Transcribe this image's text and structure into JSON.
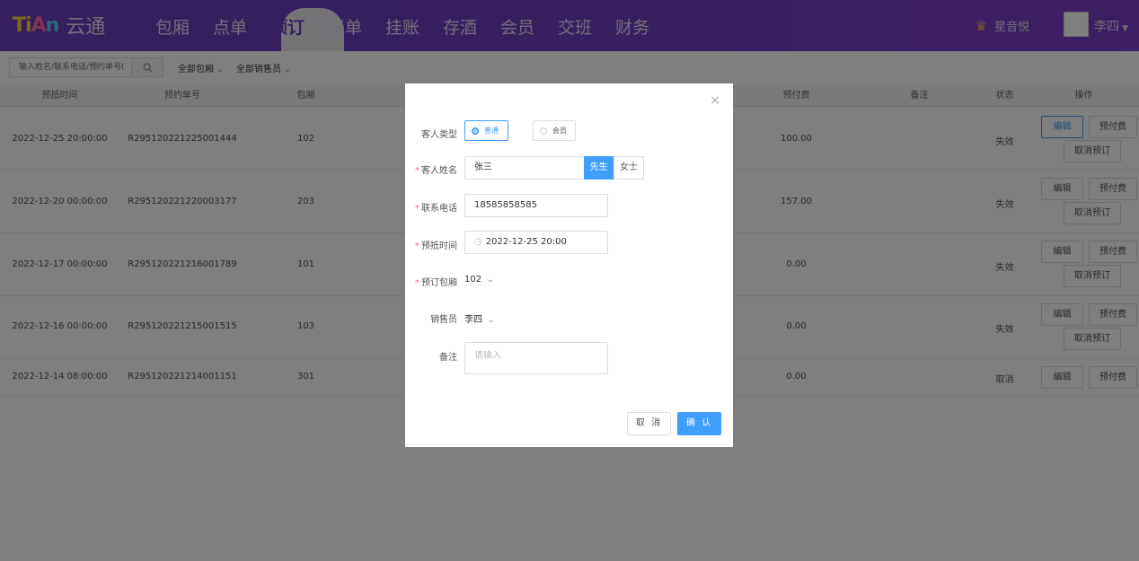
{
  "header": {
    "logo_mark": [
      "Ti",
      "A",
      "n"
    ],
    "logo_text": "云通",
    "nav": [
      "包厢",
      "点单",
      "预订",
      "账单",
      "挂账",
      "存酒",
      "会员",
      "交班",
      "财务"
    ],
    "active_nav": "预订",
    "store": "星音悦",
    "user": "李四"
  },
  "filter": {
    "search_placeholder": "输入姓名/联系电话/预约单号(",
    "room_filter": "全部包厢",
    "sales_filter": "全部销售员"
  },
  "table": {
    "columns": [
      "预抵时间",
      "预约单号",
      "包厢",
      "预付费",
      "备注",
      "状态",
      "操作"
    ],
    "rows": [
      {
        "time": "2022-12-25 20:00:00",
        "no": "R295120221225001444",
        "room": "102",
        "prepay": "100.00",
        "note": "",
        "status": "失效",
        "ops": [
          "编辑",
          "预付费",
          "取消预订"
        ]
      },
      {
        "time": "2022-12-20 00:00:00",
        "no": "R295120221220003177",
        "room": "203",
        "prepay": "157.00",
        "note": "",
        "status": "失效",
        "ops": [
          "编辑",
          "预付费",
          "取消预订"
        ]
      },
      {
        "time": "2022-12-17 00:00:00",
        "no": "R295120221216001789",
        "room": "101",
        "prepay": "0.00",
        "note": "",
        "status": "失效",
        "ops": [
          "编辑",
          "预付费",
          "取消预订"
        ]
      },
      {
        "time": "2022-12-16 00:00:00",
        "no": "R295120221215001515",
        "room": "103",
        "prepay": "0.00",
        "note": "",
        "status": "失效",
        "ops": [
          "编辑",
          "预付费",
          "取消预订"
        ]
      },
      {
        "time": "2022-12-14 08:00:00",
        "no": "R295120221214001151",
        "room": "301",
        "prepay": "0.00",
        "note": "",
        "status": "取消",
        "ops": [
          "编辑",
          "预付费"
        ]
      }
    ]
  },
  "modal": {
    "close": "×",
    "customer_type_label": "客人类型",
    "type_normal": "普通",
    "type_member": "会员",
    "name_label": "客人姓名",
    "name_value": "张三",
    "gender_male": "先生",
    "gender_female": "女士",
    "phone_label": "联系电话",
    "phone_value": "18585858585",
    "arrive_label": "预抵时间",
    "arrive_value": "2022-12-25 20:00",
    "room_label": "预订包厢",
    "room_value": "102",
    "sales_label": "销售员",
    "sales_value": "李四",
    "note_label": "备注",
    "note_placeholder": "请输入",
    "cancel": "取 消",
    "confirm": "确 认",
    "required_mark": "*"
  }
}
